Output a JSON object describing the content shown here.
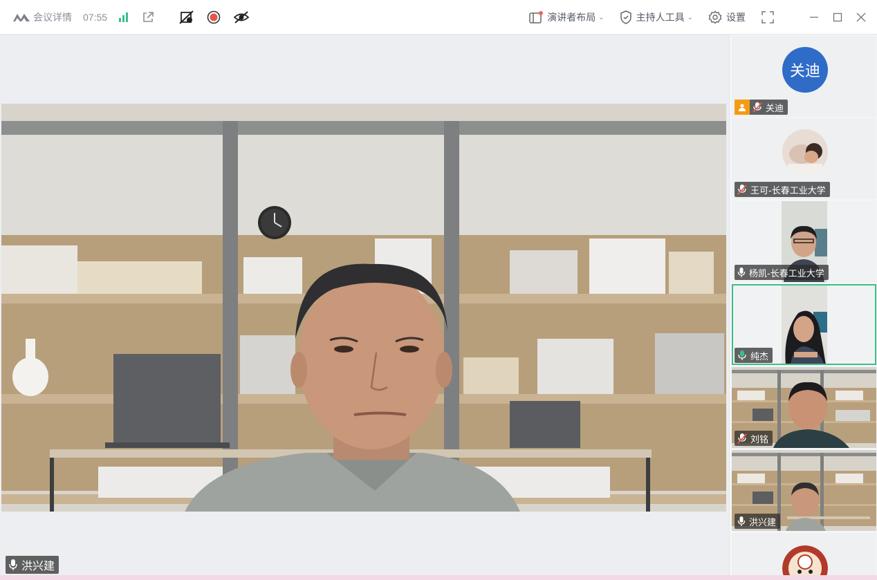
{
  "titlebar": {
    "meeting_details_label": "会议详情",
    "elapsed_time": "07:55",
    "presenter_layout_label": "演讲者布局",
    "host_tools_label": "主持人工具",
    "settings_label": "设置"
  },
  "main_video": {
    "speaker_name": "洪兴建"
  },
  "participants": [
    {
      "name": "关迪",
      "avatar_text": "关迪",
      "mic": "muted",
      "is_host": true
    },
    {
      "name": "王可-长春工业大学",
      "mic": "muted"
    },
    {
      "name": "杨凯-长春工业大学",
      "mic": "on"
    },
    {
      "name": "纯杰",
      "mic": "speaking",
      "active": true
    },
    {
      "name": "刘铭",
      "mic": "muted"
    },
    {
      "name": "洪兴建",
      "mic": "on"
    }
  ],
  "colors": {
    "accent_active": "#3bbf8a",
    "avatar_blue": "#2f6cc7",
    "host_badge": "#f39c12",
    "record_red": "#e8534a"
  }
}
